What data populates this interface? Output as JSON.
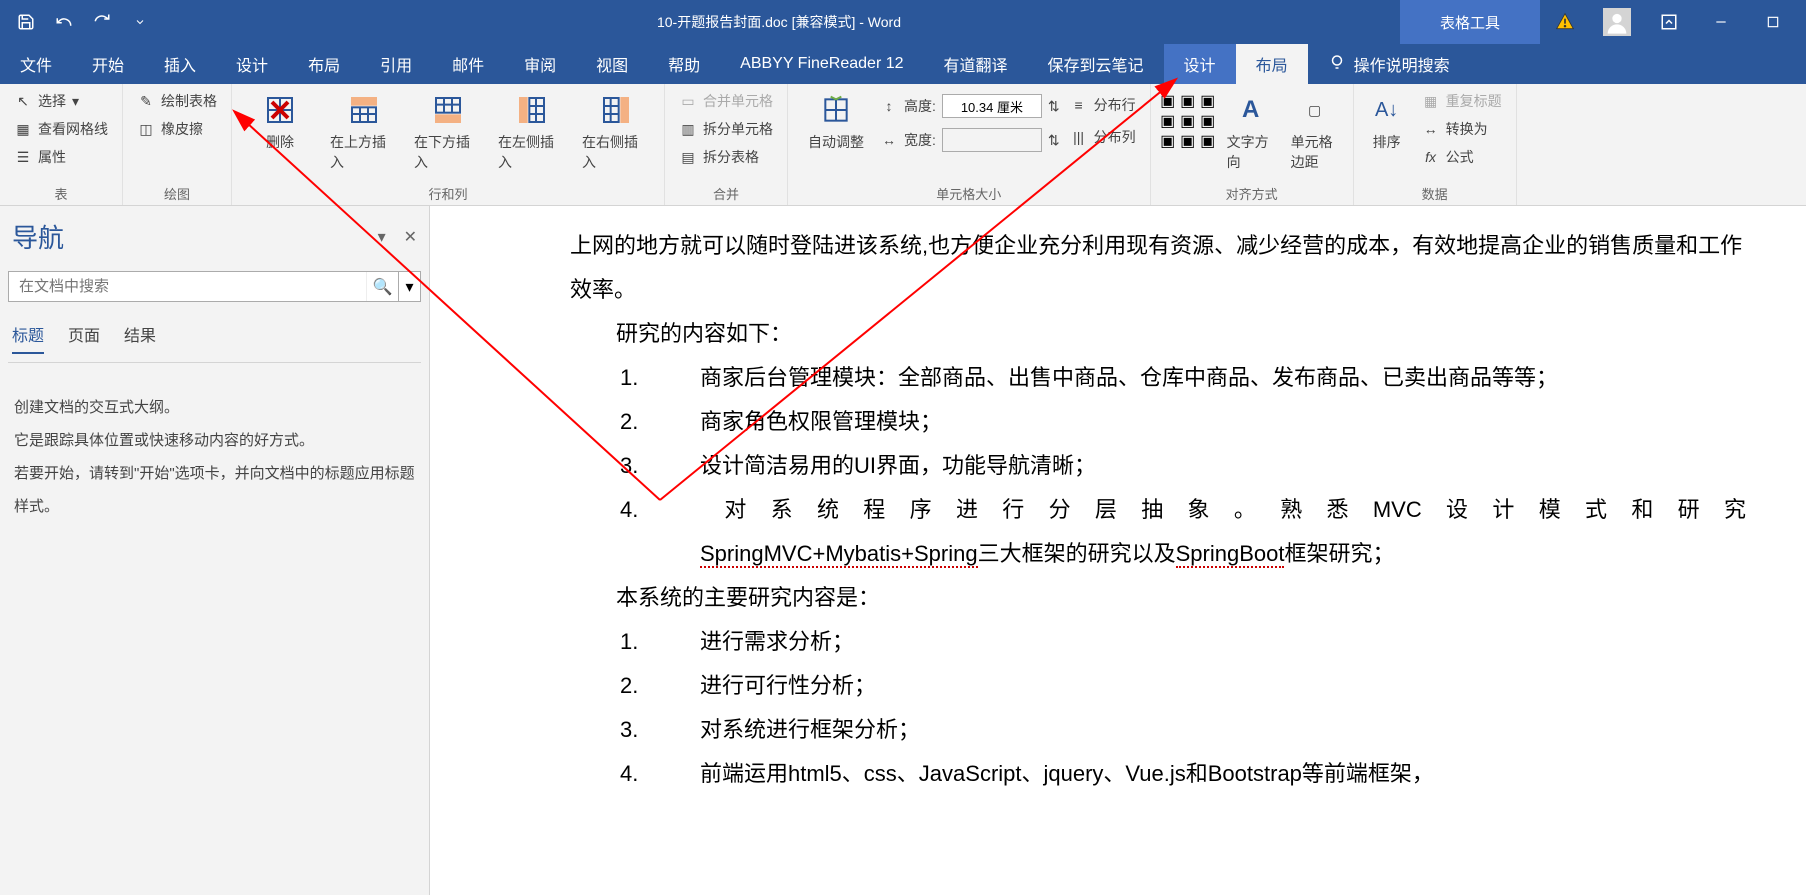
{
  "titlebar": {
    "title": "10-开题报告封面.doc [兼容模式] - Word",
    "context_tab": "表格工具"
  },
  "menu": {
    "file": "文件",
    "home": "开始",
    "insert": "插入",
    "design": "设计",
    "layout": "布局",
    "references": "引用",
    "mailings": "邮件",
    "review": "审阅",
    "view": "视图",
    "help": "帮助",
    "abbyy": "ABBYY FineReader 12",
    "youdao": "有道翻译",
    "cloud": "保存到云笔记",
    "ctx_design": "设计",
    "ctx_layout": "布局",
    "tell_me": "操作说明搜索"
  },
  "ribbon": {
    "table": {
      "select": "选择",
      "gridlines": "查看网格线",
      "properties": "属性",
      "label": "表"
    },
    "draw": {
      "draw_table": "绘制表格",
      "eraser": "橡皮擦",
      "label": "绘图"
    },
    "rowscols": {
      "delete": "删除",
      "insert_above": "在上方插入",
      "insert_below": "在下方插入",
      "insert_left": "在左侧插入",
      "insert_right": "在右侧插入",
      "label": "行和列"
    },
    "merge": {
      "merge_cells": "合并单元格",
      "split_cells": "拆分单元格",
      "split_table": "拆分表格",
      "label": "合并"
    },
    "cellsize": {
      "autofit": "自动调整",
      "height": "高度:",
      "height_val": "10.34 厘米",
      "width": "宽度:",
      "width_val": "",
      "dist_rows": "分布行",
      "dist_cols": "分布列",
      "label": "单元格大小"
    },
    "alignment": {
      "text_direction": "文字方向",
      "cell_margins": "单元格边距",
      "label": "对齐方式"
    },
    "data": {
      "sort": "排序",
      "repeat_header": "重复标题",
      "convert": "转换为",
      "formula": "公式",
      "label": "数据"
    }
  },
  "nav": {
    "title": "导航",
    "search_placeholder": "在文档中搜索",
    "tabs": {
      "headings": "标题",
      "pages": "页面",
      "results": "结果"
    },
    "body": {
      "l1": "创建文档的交互式大纲。",
      "l2": "它是跟踪具体位置或快速移动内容的好方式。",
      "l3": "若要开始，请转到\"开始\"选项卡，并向文档中的标题应用标题样式。"
    }
  },
  "doc": {
    "p1": "上网的地方就可以随时登陆进该系统,也方便企业充分利用现有资源、减少经营的成本，有效地提高企业的销售质量和工作效率。",
    "p2": "研究的内容如下：",
    "li1": "商家后台管理模块：全部商品、出售中商品、仓库中商品、发布商品、已卖出商品等等；",
    "li2": "商家角色权限管理模块；",
    "li3": "设计简洁易用的UI界面，功能导航清晰；",
    "li4a": "对系统程序进行分层抽象。熟悉MVC设计模式和研究",
    "li4b": "SpringMVC+Mybatis+Spring",
    "li4c": "三大框架的研究以及",
    "li4d": "SpringBoot",
    "li4e": "框架研究；",
    "p3": "本系统的主要研究内容是：",
    "li5": "进行需求分析；",
    "li6": "进行可行性分析；",
    "li7": "对系统进行框架分析；",
    "li8": "前端运用html5、css、JavaScript、jquery、Vue.js和Bootstrap等前端框架，"
  }
}
